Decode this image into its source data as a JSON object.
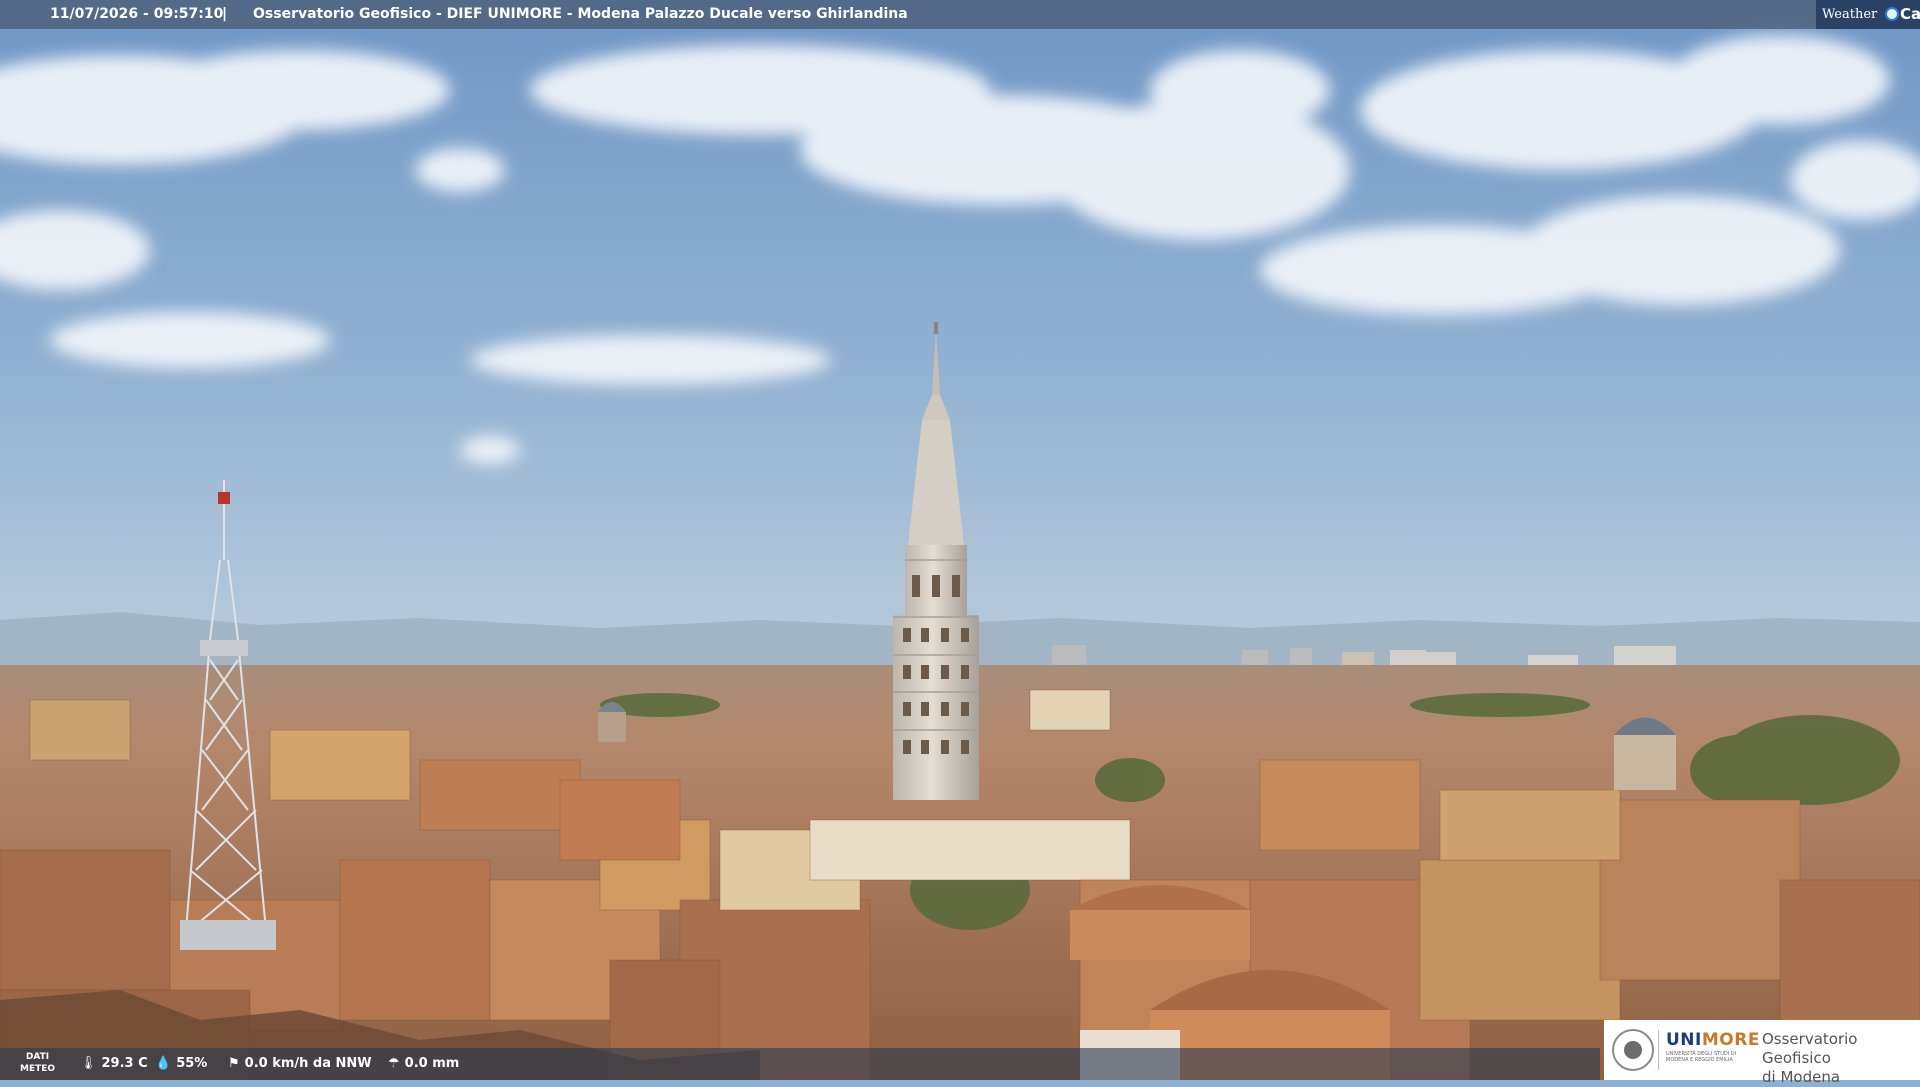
{
  "overlay": {
    "timestamp": "11/07/2026 - 09:57:10",
    "separator": "|",
    "camera_title": "Osservatorio Geofisico - DIEF UNIMORE - Modena Palazzo Ducale verso Ghirlandina"
  },
  "weathercam_logo": {
    "word": "Weather",
    "cam": "Cam"
  },
  "meteo": {
    "label_line1": "DATI",
    "label_line2": "METEO",
    "temperature": "29.3 C",
    "humidity": "55%",
    "wind": "0.0 km/h da NNW",
    "rain": "0.0 mm",
    "icons": [
      "thermometer-icon",
      "humidity-drop-icon",
      "wind-icon",
      "rain-icon"
    ]
  },
  "unimore_logo": {
    "brand_uni": "UNI",
    "brand_more": "MORE",
    "subtitle": "UNIVERSITÀ DEGLI STUDI DI MODENA E REGGIO EMILIA",
    "entity_line1": "Osservatorio Geofisico",
    "entity_line2": "di Modena"
  },
  "colors": {
    "sky_top": "#6f97c6",
    "sky_horizon": "#b8cadb",
    "roof": "#b77a52",
    "tower": "#d8d2c8",
    "unimore_blue": "#1b3e7a",
    "unimore_orange": "#c8792a"
  }
}
